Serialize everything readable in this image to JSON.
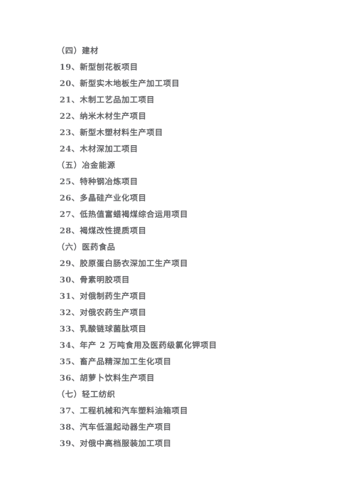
{
  "document": {
    "page_background": "#ffffff",
    "text_color": "#55565a",
    "lines": [
      {
        "kind": "section",
        "text": "（四）建材"
      },
      {
        "kind": "item",
        "text": "19、新型刨花板项目"
      },
      {
        "kind": "item",
        "text": "20、新型实木地板生产加工项目"
      },
      {
        "kind": "item",
        "text": "21、木制工艺品加工项目"
      },
      {
        "kind": "item",
        "text": "22、纳米木材生产项目"
      },
      {
        "kind": "item",
        "text": "23、新型木塑材料生产项目"
      },
      {
        "kind": "item",
        "text": "24、木材深加工项目"
      },
      {
        "kind": "section",
        "text": "（五）冶金能源"
      },
      {
        "kind": "item",
        "text": "25、特种钢冶炼项目"
      },
      {
        "kind": "item",
        "text": "26、多晶硅产业化项目"
      },
      {
        "kind": "item",
        "text": "27、低热值富蜡褐煤综合运用项目"
      },
      {
        "kind": "item",
        "text": "28、褐煤改性提质项目"
      },
      {
        "kind": "section",
        "text": "（六）医药食品"
      },
      {
        "kind": "item",
        "text": "29、胶原蛋白肠衣深加工生产项目"
      },
      {
        "kind": "item",
        "text": "30、骨素明胶项目"
      },
      {
        "kind": "item",
        "text": "31、对俄制药生产项目"
      },
      {
        "kind": "item",
        "text": "32、对俄农药生产项目"
      },
      {
        "kind": "item",
        "text": "33、乳酸链球菌肽项目"
      },
      {
        "kind": "item",
        "text": "34、年产 2 万吨食用及医药级氯化钾项目"
      },
      {
        "kind": "item",
        "text": "35、畜产品精深加工生化项目"
      },
      {
        "kind": "item",
        "text": "36、胡萝卜饮料生产项目"
      },
      {
        "kind": "section",
        "text": "（七）轻工纺织"
      },
      {
        "kind": "item",
        "text": "37、工程机械和汽车塑料油箱项目"
      },
      {
        "kind": "item",
        "text": "38、汽车低温起动器生产项目"
      },
      {
        "kind": "item",
        "text": "39、对俄中高档服装加工项目"
      }
    ]
  }
}
